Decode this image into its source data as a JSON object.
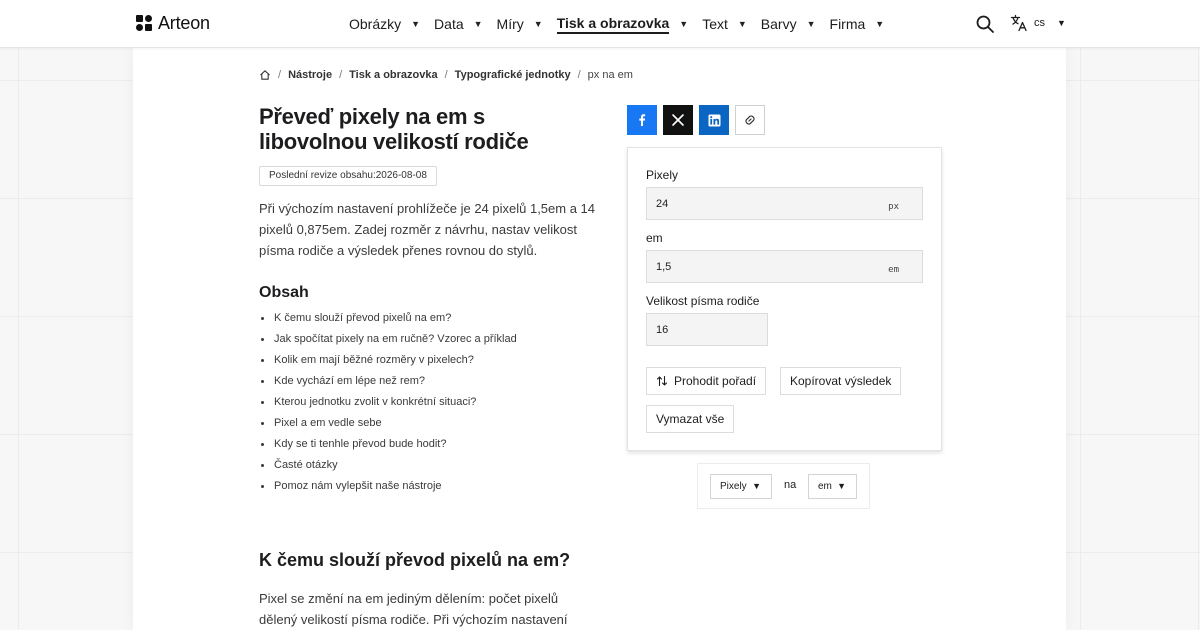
{
  "header": {
    "brand": "Arteon",
    "nav": [
      {
        "label": "Obrázky",
        "active": false
      },
      {
        "label": "Data",
        "active": false
      },
      {
        "label": "Míry",
        "active": false
      },
      {
        "label": "Tisk a obrazovka",
        "active": true
      },
      {
        "label": "Text",
        "active": false
      },
      {
        "label": "Barvy",
        "active": false
      },
      {
        "label": "Firma",
        "active": false
      }
    ],
    "nav_caret": "▼",
    "language": "cs"
  },
  "breadcrumb": {
    "separator": "/",
    "items": [
      "Nástroje",
      "Tisk a obrazovka",
      "Typografické jednotky"
    ],
    "current": "px na em"
  },
  "article": {
    "title": "Převeď pixely na em s libovolnou velikostí rodiče",
    "revision": "Poslední revize obsahu:2026-08-08",
    "intro": "Při výchozím nastavení prohlížeče je 24 pixelů 1,5em a 14 pixelů 0,875em. Zadej rozměr z návrhu, nastav velikost písma rodiče a výsledek přenes rovnou do stylů.",
    "toc_title": "Obsah",
    "toc": [
      "K čemu slouží převod pixelů na em?",
      "Jak spočítat pixely na em ručně? Vzorec a příklad",
      "Kolik em mají běžné rozměry v pixelech?",
      "Kde vychází em lépe než rem?",
      "Kterou jednotku zvolit v konkrétní situaci?",
      "Pixel a em vedle sebe",
      "Kdy se ti tenhle převod bude hodit?",
      "Časté otázky",
      "Pomoz nám vylepšit naše nástroje"
    ],
    "section_heading": "K čemu slouží převod pixelů na em?",
    "section_text": "Pixel se změní na em jediným dělením: počet pixelů dělený velikostí písma rodiče. Při výchozím nastavení prohlížeče"
  },
  "share": {
    "icons": [
      "facebook-icon",
      "x-icon",
      "linkedin-icon",
      "link-icon"
    ],
    "colors": {
      "facebook": "#1877f2",
      "x": "#111111",
      "linkedin": "#0a66c2"
    }
  },
  "converter": {
    "pixels": {
      "label": "Pixely",
      "value": "24",
      "unit": "px"
    },
    "em": {
      "label": "em",
      "value": "1,5",
      "unit": "em"
    },
    "parent": {
      "label": "Velikost písma rodiče",
      "value": "16"
    },
    "swap_label": "Prohodit pořadí",
    "copy_label": "Kopírovat výsledek",
    "clear_label": "Vymazat vše"
  },
  "unit_selector": {
    "from": "Pixely",
    "to_word": "na",
    "to": "em"
  }
}
